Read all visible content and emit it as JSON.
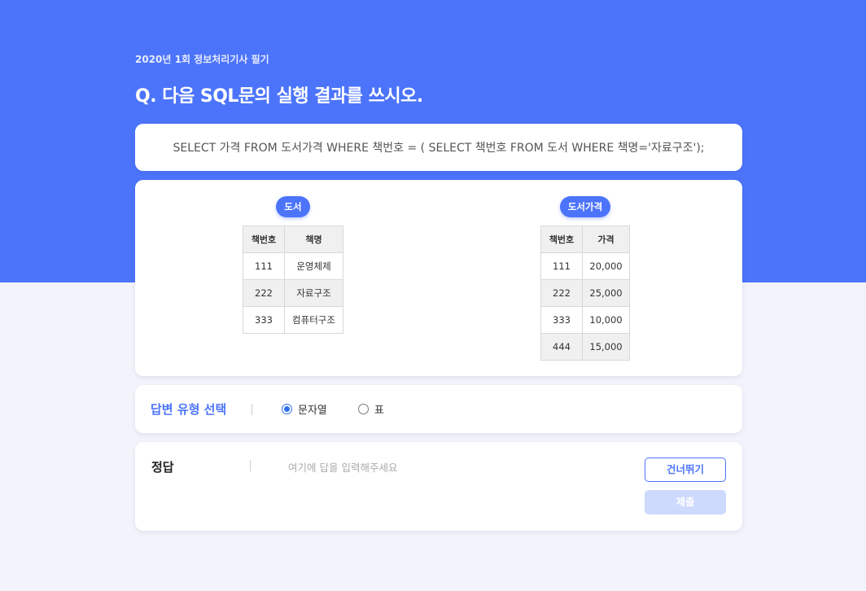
{
  "header": {
    "subtitle": "2020년 1회 정보처리기사 필기",
    "question": "Q. 다음 SQL문의 실행 결과를 쓰시오."
  },
  "sql": {
    "text": "SELECT 가격 FROM 도서가격 WHERE 책번호 = ( SELECT 책번호 FROM 도서 WHERE 책명='자료구조');"
  },
  "tables": [
    {
      "label": "도서",
      "headers": [
        "책번호",
        "책명"
      ],
      "rows": [
        [
          "111",
          "운영체제"
        ],
        [
          "222",
          "자료구조"
        ],
        [
          "333",
          "컴퓨터구조"
        ]
      ]
    },
    {
      "label": "도서가격",
      "headers": [
        "책번호",
        "가격"
      ],
      "rows": [
        [
          "111",
          "20,000"
        ],
        [
          "222",
          "25,000"
        ],
        [
          "333",
          "10,000"
        ],
        [
          "444",
          "15,000"
        ]
      ]
    }
  ],
  "answer_type": {
    "title": "답변 유형 선택",
    "options": [
      "문자열",
      "표"
    ],
    "selected": "문자열"
  },
  "answer": {
    "title": "정답",
    "placeholder": "여기에 답을 입력해주세요",
    "skip_label": "건너뛰기",
    "submit_label": "제출"
  },
  "colors": {
    "brand": "#4c74fb",
    "page_bg": "#f3f4fb",
    "submit_disabled": "#cdd9fd"
  }
}
